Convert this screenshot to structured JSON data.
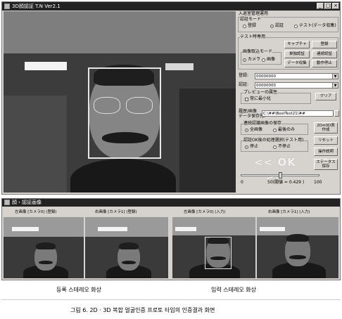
{
  "main_window": {
    "title": "3D顔認証 T.N Ver2.1",
    "controls": {
      "minimize": "_",
      "maximize": "□",
      "close": "×"
    }
  },
  "panel": {
    "section_title": "入退室管理運用",
    "auth_mode": {
      "label": "認証モード",
      "options": [
        "登録",
        "認証",
        "テスト(データ収集)"
      ],
      "selected": "認証"
    },
    "test_group": {
      "label": "テスト時専用",
      "capture_button": "キャプチャ",
      "register_button": "登録",
      "image_input_mode_label": "画像取込モード",
      "input_options": [
        "カメラ",
        "画像"
      ],
      "input_selected": "カメラ",
      "single_auth_button": "単独認証",
      "continuous_auth_button": "連続認証",
      "data_collect_button": "データ収集",
      "stop_button": "動作停止"
    },
    "register_field": {
      "label": "登録:",
      "value": "00000000"
    },
    "auth_field": {
      "label": "認証:",
      "value": "00000000"
    },
    "preview_group": {
      "label": "プレビューの属性",
      "checkbox_label": "常に最小化",
      "checked": false,
      "clear_button": "クリア"
    },
    "history_label_1": "履歴/画像",
    "history_label_2": "データ保存先:",
    "history_path": "C:\\##\\BestTest21\\##",
    "continuous_group": {
      "label": "連続認識画像の保存",
      "options": [
        "全画像",
        "最後のみ"
      ],
      "selected": "全画像"
    },
    "auth_ok_group": {
      "label": "認証OK後の処理選択(テスト用)",
      "options": [
        "停止",
        "不停止"
      ],
      "selected": "停止"
    },
    "result_banner": "<< OK >>",
    "slider": {
      "min_label": "0",
      "max_label": "100",
      "threshold_text": "50(閾値 = 0.429 )",
      "value_percent": 50
    },
    "side_buttons": {
      "create_2d3d": "2D⇔3D表\n作成",
      "reset": "リセット",
      "operation_help": "操作説明",
      "status_save": "ステータス\n保存"
    }
  },
  "sub_window": {
    "title": "顔・認証画像",
    "thumb_labels": [
      "左画像 [カメラ0] (登録)",
      "右画像 [カメラ1] (登録)",
      "左画像 [カメラ0] (入力)",
      "右画像 [カメラ1] (入力)"
    ]
  },
  "captions": {
    "registered": "등록 스테레오 화상",
    "input": "입력 스테레오 화상",
    "figure": "그림 6. 2D · 3D 복합 얼굴인증 프로토 타입의 인증결과 화면"
  }
}
